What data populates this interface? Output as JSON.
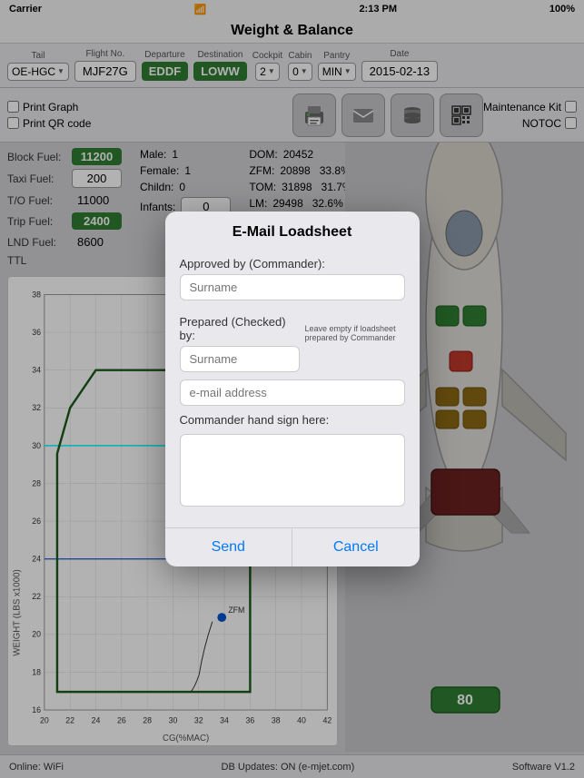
{
  "statusBar": {
    "carrier": "Carrier",
    "wifi": "WiFi",
    "time": "2:13 PM",
    "battery": "100%"
  },
  "titleBar": {
    "title": "Weight & Balance"
  },
  "header": {
    "tailLabel": "Tail",
    "tailValue": "OE-HGC",
    "flightNoLabel": "Flight No.",
    "flightNoValue": "MJF27G",
    "departureLabel": "Departure",
    "departureValue": "EDDF",
    "destinationLabel": "Destination",
    "destinationValue": "LOWW",
    "cockpitLabel": "Cockpit",
    "cockpitValue": "2",
    "cabinLabel": "Cabin",
    "cabinValue": "0",
    "pantryLabel": "Pantry",
    "pantryValue": "MIN",
    "dateLabel": "Date",
    "dateValue": "2015-02-13"
  },
  "toolbar": {
    "printGraphLabel": "Print Graph",
    "printQRLabel": "Print QR code",
    "maintenanceKitLabel": "Maintenance Kit",
    "notocLabel": "NOTOC"
  },
  "fuelData": {
    "blockFuelLabel": "Block Fuel:",
    "blockFuelValue": "11200",
    "taxiFuelLabel": "Taxi Fuel:",
    "taxiFuelValue": "200",
    "toFuelLabel": "T/O Fuel:",
    "toFuelValue": "11000",
    "tripFuelLabel": "Trip Fuel:",
    "tripFuelValue": "2400",
    "lndFuelLabel": "LND Fuel:",
    "lndFuelValue": "8600",
    "ttlLabel": "TTL"
  },
  "paxData": {
    "maleLabel": "Male:",
    "maleValue": "1",
    "femaleLabel": "Female:",
    "femaleValue": "1",
    "childrenLabel": "Childn:",
    "childrenValue": "0",
    "infantsLabel": "Infants:",
    "infantsValue": "0"
  },
  "weightData": {
    "domLabel": "DOM:",
    "domValue": "20452",
    "zfmLabel": "ZFM:",
    "zfmValue": "20898",
    "zfmPct": "33.8%",
    "tomLabel": "TOM:",
    "tomValue": "31898",
    "tomPct": "31.7%",
    "lmLabel": "LM:",
    "lmValue": "29498",
    "lmPct": "32.6%"
  },
  "chart": {
    "xLabel": "CG(%MAC)",
    "yLabel": "WEIGHT (LBS x1000)",
    "xMin": 20,
    "xMax": 42,
    "yMin": 16,
    "yMax": 38,
    "zfmLabel": "ZFM",
    "zfmX": 33.8,
    "zfmY": 20.898
  },
  "modal": {
    "title": "E-Mail Loadsheet",
    "approvedByLabel": "Approved by (Commander):",
    "approvedByPlaceholder": "Surname",
    "preparedByLabel": "Prepared (Checked) by:",
    "preparedByPlaceholder": "Surname",
    "preparedHint": "Leave empty if loadsheet prepared by Commander",
    "emailPlaceholder": "e-mail address",
    "handSignLabel": "Commander hand sign here:",
    "sendLabel": "Send",
    "cancelLabel": "Cancel"
  },
  "footer": {
    "online": "Online: WiFi",
    "db": "DB Updates: ON   (e-mjet.com)",
    "software": "Software V1.2"
  },
  "aircraft": {
    "cargoLabel": "80"
  }
}
